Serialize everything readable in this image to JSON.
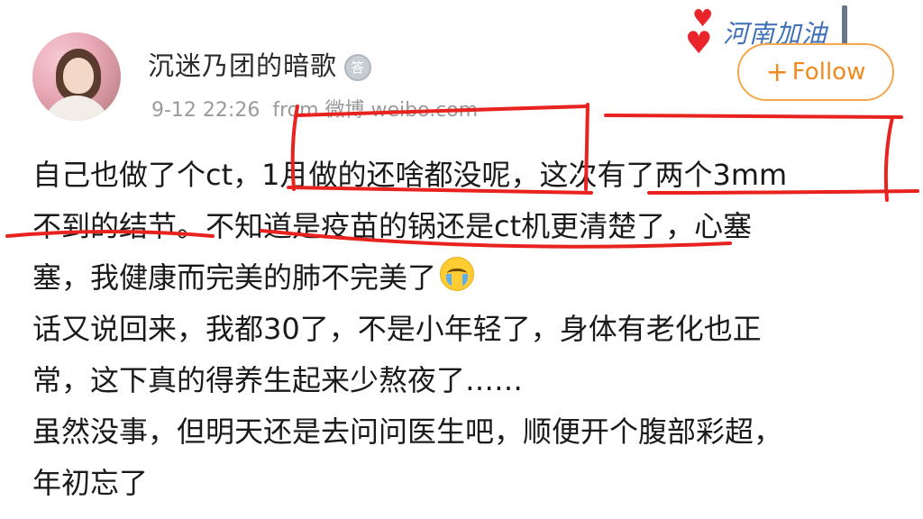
{
  "post_header": {
    "username": "沉迷乃团的暗歌",
    "medal_glyph": "答",
    "timestamp": "9-12 22:26",
    "source": "from 微博 weibo.com"
  },
  "location_badge": {
    "text": "河南加油",
    "icon": "heart-icon"
  },
  "follow_button": {
    "plus": "+",
    "label": "Follow"
  },
  "post_body": {
    "lines": [
      "自己也做了个ct，1月做的还啥都没呢，这次有了两个3mm",
      "不到的结节。不知道是疫苗的锅还是ct机更清楚了，心塞",
      "塞，我健康而完美的肺不完美了",
      "话又说回来，我都30了，不是小年轻了，身体有老化也正",
      "常，这下真的得养生起来少熬夜了……",
      "虽然没事，但明天还是去问问医生吧，顺便开个腹部彩超，",
      "年初忘了"
    ],
    "emoji": "crying-face-emoji"
  },
  "colors": {
    "follow_accent": "#f08a1e",
    "annotation_red": "#e8231f",
    "meta_gray": "#9a9a9a"
  }
}
